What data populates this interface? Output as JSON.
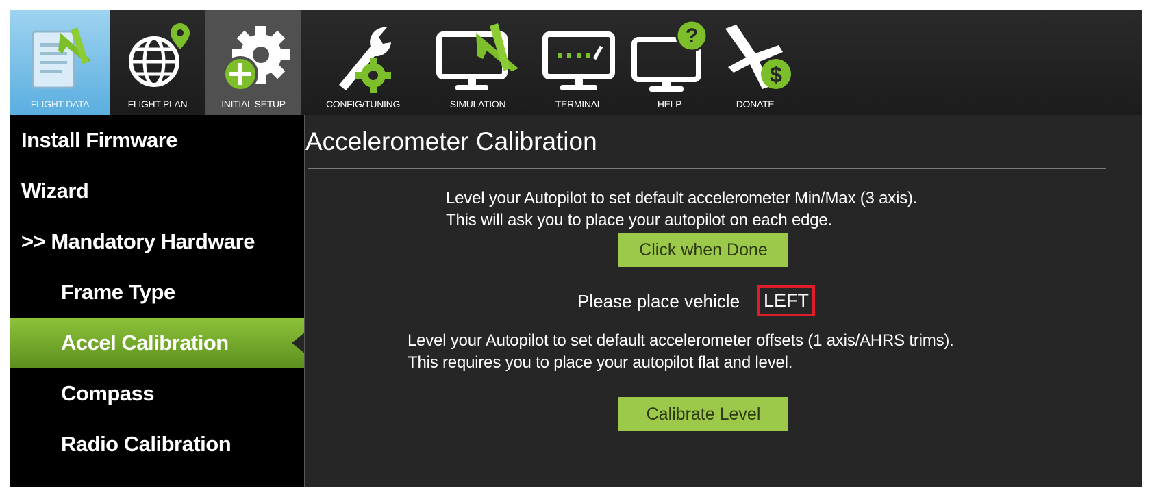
{
  "toolbar": {
    "items": [
      {
        "label": "FLIGHT DATA",
        "icon": "flight-data-icon",
        "state": "active"
      },
      {
        "label": "FLIGHT PLAN",
        "icon": "flight-plan-icon"
      },
      {
        "label": "INITIAL SETUP",
        "icon": "initial-setup-icon",
        "state": "selected"
      },
      {
        "label": "CONFIG/TUNING",
        "icon": "config-tuning-icon"
      },
      {
        "label": "SIMULATION",
        "icon": "simulation-icon"
      },
      {
        "label": "TERMINAL",
        "icon": "terminal-icon"
      },
      {
        "label": "HELP",
        "icon": "help-icon"
      },
      {
        "label": "DONATE",
        "icon": "donate-icon"
      }
    ]
  },
  "sidebar": {
    "items": [
      {
        "label": "Install Firmware"
      },
      {
        "label": "Wizard"
      },
      {
        "label": ">> Mandatory Hardware"
      },
      {
        "label": "Frame Type"
      },
      {
        "label": "Accel Calibration",
        "selected": true
      },
      {
        "label": "Compass"
      },
      {
        "label": "Radio Calibration"
      }
    ]
  },
  "main": {
    "title": "Accelerometer Calibration",
    "instructions_minmax": {
      "line1": "Level your Autopilot to set default accelerometer Min/Max (3 axis).",
      "line2": "This will ask you to place your autopilot on each edge."
    },
    "click_when_done_button": "Click when Done",
    "status": {
      "prefix": "Please place vehicle",
      "value": "LEFT"
    },
    "instructions_level": {
      "line1": "Level your Autopilot to set default accelerometer offsets (1 axis/AHRS trims).",
      "line2": "This requires you to place your autopilot flat and level."
    },
    "calibrate_level_button": "Calibrate Level"
  },
  "colors": {
    "accent_green": "#9cc94a",
    "selected_green": "#7bb02f",
    "highlight_red": "#e01e2b",
    "active_blue": "#7fc3ea"
  }
}
